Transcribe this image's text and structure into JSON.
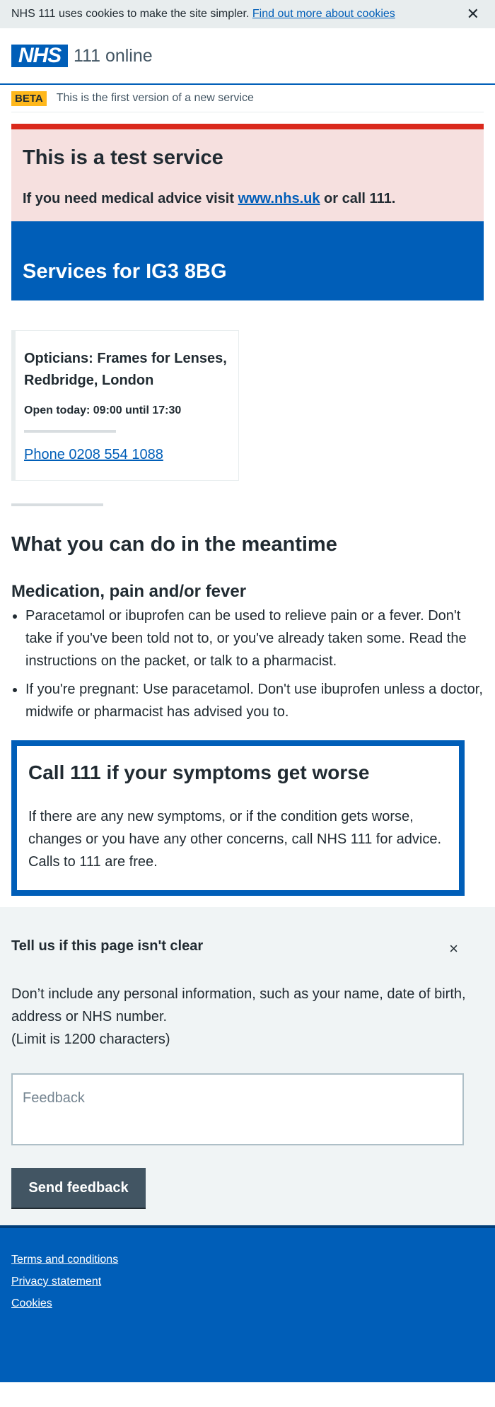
{
  "cookie_banner": {
    "text": "NHS 111 uses cookies to make the site simpler.",
    "link": "Find out more about cookies",
    "close": "✕"
  },
  "header": {
    "logo": "NHS",
    "service_name": "111 online"
  },
  "beta": {
    "tag": "BETA",
    "text": "This is the first version of a new service"
  },
  "test_service": {
    "title": "This is a test service",
    "text_before": "If you need medical advice visit ",
    "link": "www.nhs.uk",
    "text_after": " or call 111."
  },
  "services_heading": "Services for IG3 8BG",
  "service_card": {
    "name": "Opticians: Frames for Lenses, Redbridge, London",
    "hours": "Open today: 09:00 until 17:30",
    "phone": "Phone 0208 554 1088"
  },
  "meanwhile": {
    "title": "What you can do in the meantime",
    "subtitle": "Medication, pain and/or fever",
    "items": [
      "Paracetamol or ibuprofen can be used to relieve pain or a fever. Don't take if you've been told not to, or you've already taken some. Read the instructions on the packet, or talk to a pharmacist.",
      "If you're pregnant: Use paracetamol. Don't use ibuprofen unless a doctor, midwife or pharmacist has advised you to."
    ]
  },
  "care_card": {
    "title": "Call 111 if your symptoms get worse",
    "text": "If there are any new symptoms, or if the condition gets worse, changes or you have any other concerns, call NHS 111 for advice. Calls to 111 are free."
  },
  "feedback": {
    "title": "Tell us if this page isn't clear",
    "close": "×",
    "info": "Don’t include any personal information, such as your name, date of birth, address or NHS number.",
    "limit": "(Limit is 1200 characters)",
    "placeholder": "Feedback",
    "button": "Send feedback"
  },
  "footer": {
    "links": [
      "Terms and conditions",
      "Privacy statement",
      "Cookies"
    ]
  }
}
